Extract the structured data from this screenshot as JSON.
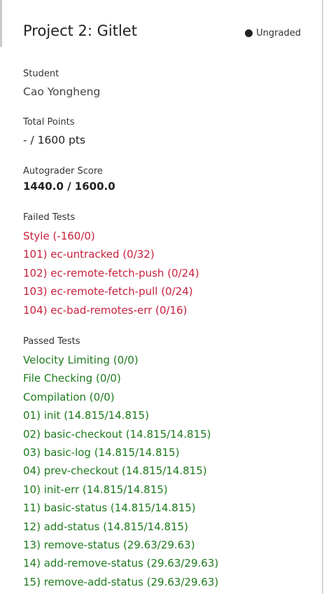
{
  "assignment": {
    "title": "Project 2: Gitlet",
    "status_label": "Ungraded"
  },
  "student": {
    "label": "Student",
    "name": "Cao Yongheng"
  },
  "total_points": {
    "label": "Total Points",
    "value": "- / 1600 pts"
  },
  "autograder": {
    "label": "Autograder Score",
    "value": "1440.0 / 1600.0"
  },
  "failed_tests": {
    "label": "Failed Tests",
    "items": [
      "Style (-160/0)",
      "101) ec-untracked (0/32)",
      "102) ec-remote-fetch-push (0/24)",
      "103) ec-remote-fetch-pull (0/24)",
      "104) ec-bad-remotes-err (0/16)"
    ]
  },
  "passed_tests": {
    "label": "Passed Tests",
    "items": [
      "Velocity Limiting (0/0)",
      "File Checking (0/0)",
      "Compilation (0/0)",
      "01) init (14.815/14.815)",
      "02) basic-checkout (14.815/14.815)",
      "03) basic-log (14.815/14.815)",
      "04) prev-checkout (14.815/14.815)",
      "10) init-err (14.815/14.815)",
      "11) basic-status (14.815/14.815)",
      "12) add-status (14.815/14.815)",
      "13) remove-status (29.63/29.63)",
      "14) add-remove-status (29.63/29.63)",
      "15) remove-add-status (29.63/29.63)"
    ]
  },
  "colors": {
    "failed": "#c8203c",
    "passed": "#1e7a1e"
  }
}
